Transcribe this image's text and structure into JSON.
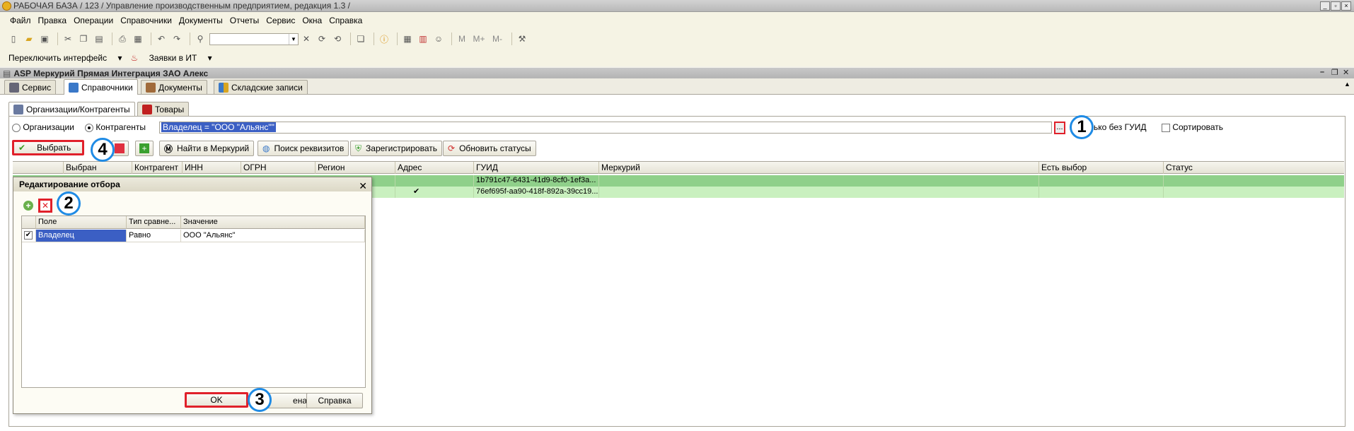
{
  "window": {
    "title": "РАБОЧАЯ БАЗА / 123 /  Управление производственным предприятием, редакция 1.3 /"
  },
  "menu": [
    "Файл",
    "Правка",
    "Операции",
    "Справочники",
    "Документы",
    "Отчеты",
    "Сервис",
    "Окна",
    "Справка"
  ],
  "toolbar2": {
    "switch_interface": "Переключить интерфейс",
    "it_requests": "Заявки в ИТ"
  },
  "toolbar_text_icons": {
    "m": "M",
    "m_plus": "M+",
    "m_minus": "M-"
  },
  "document": {
    "title": "ASP Меркурий Прямая Интеграция ЗАО Алекс"
  },
  "tabs_main": [
    {
      "label": "Сервис",
      "active": false
    },
    {
      "label": "Справочники",
      "active": true
    },
    {
      "label": "Документы",
      "active": false
    },
    {
      "label": "Складские записи",
      "active": false
    }
  ],
  "tabs_sub": [
    {
      "label": "Организации/Контрагенты",
      "active": true
    },
    {
      "label": "Товары",
      "active": false
    }
  ],
  "filter": {
    "radio_org": "Организации",
    "radio_contr": "Контрагенты",
    "selected": "Контрагенты",
    "value": "Владелец = \"ООО \"Альянс\"\"",
    "dots": "...",
    "only_no_guid": "Только без ГУИД",
    "only_no_guid_visible": "лько без ГУИД",
    "sort": "Сортировать"
  },
  "actions": {
    "select": "Выбрать",
    "find_mercury": "Найти в Меркурий",
    "search_requisites": "Поиск реквизитов",
    "register": "Зарегистрировать",
    "update_status": "Обновить статусы"
  },
  "grid": {
    "columns": [
      "Выбран",
      "Контрагент",
      "ИНН",
      "ОГРН",
      "Регион",
      "Адрес",
      "ГУИД",
      "Меркурий",
      "Есть выбор",
      "Статус"
    ],
    "rows": [
      {
        "address_check": "",
        "guid": "1b791c47-6431-41d9-8cf0-1ef3a..."
      },
      {
        "address_check": "✔",
        "guid": "76ef695f-aa90-418f-892a-39cc19..."
      }
    ]
  },
  "dialog": {
    "title": "Редактирование отбора",
    "close": "✕",
    "columns": [
      "Поле",
      "Тип сравне...",
      "Значение"
    ],
    "rows": [
      {
        "checked": "✔",
        "field": "Владелец",
        "type": "Равно",
        "value": "ООО \"Альянс\""
      }
    ],
    "ok": "OK",
    "cancel_visible": "ена",
    "help": "Справка"
  },
  "annotations": [
    "1",
    "2",
    "3",
    "4"
  ],
  "colors": {
    "row_selected": "#8fd08a",
    "row_normal": "#c9f0bf",
    "highlight_blue": "#3b5fc4",
    "annotation_red": "#e0202a",
    "annotation_blue": "#1f8be5"
  }
}
